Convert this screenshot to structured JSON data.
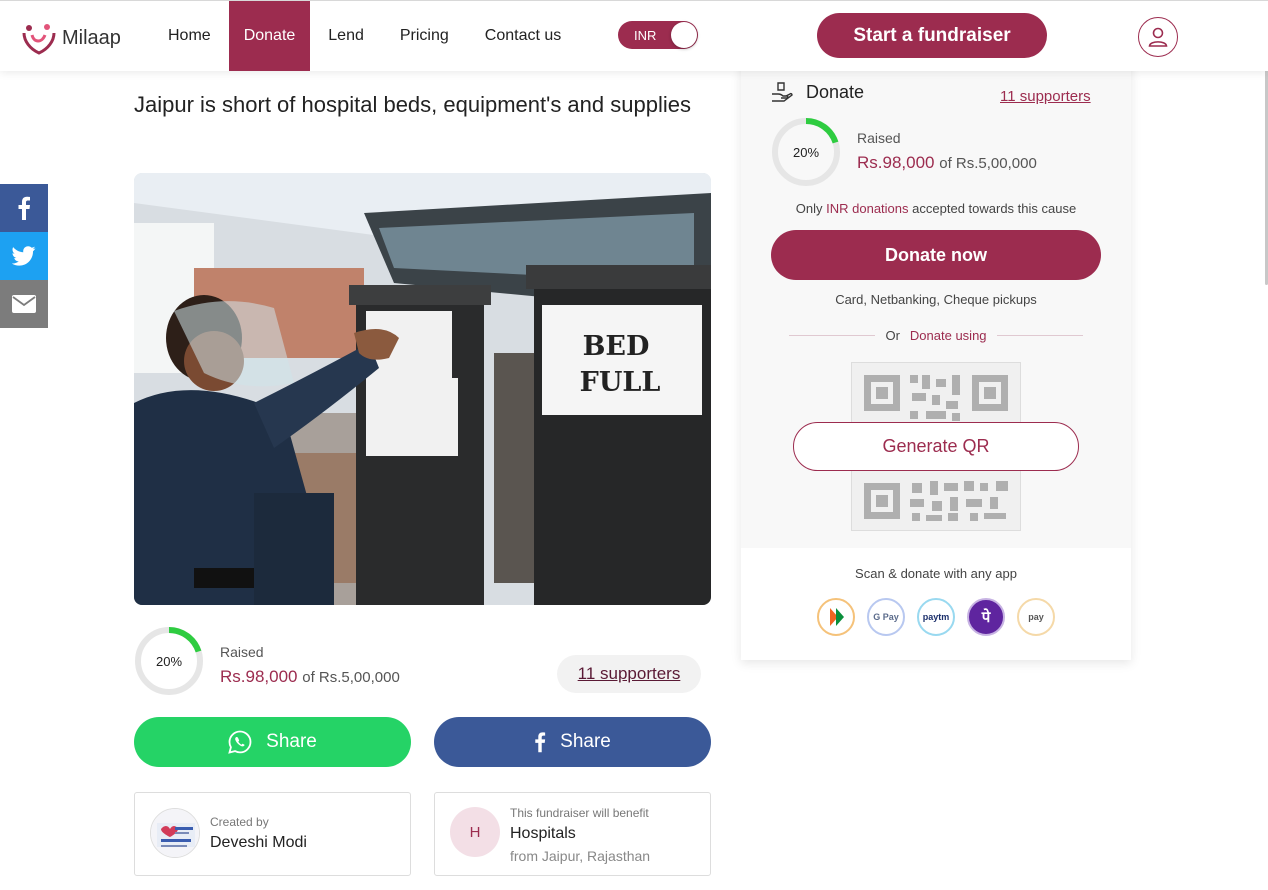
{
  "header": {
    "logo_text": "Milaap",
    "nav": [
      {
        "label": "Home"
      },
      {
        "label": "Donate"
      },
      {
        "label": "Lend"
      },
      {
        "label": "Pricing"
      },
      {
        "label": "Contact us"
      }
    ],
    "currency_toggle": "INR",
    "start_button": "Start a fundraiser"
  },
  "campaign": {
    "title": "Jaipur is short of hospital beds, equipment's and supplies",
    "photo_sign_text_1": "BED",
    "photo_sign_text_2": "FULL",
    "progress_percent": 20,
    "progress_label": "20%",
    "raised_label": "Raised",
    "raised_amount": "Rs.98,000",
    "raised_of": "of Rs.5,00,000",
    "supporters": "11 supporters"
  },
  "share": {
    "whatsapp_label": "Share",
    "facebook_label": "Share"
  },
  "creator": {
    "label": "Created by",
    "name": "Deveshi Modi"
  },
  "beneficiary": {
    "label": "This fundraiser will benefit",
    "initial": "H",
    "name": "Hospitals",
    "location": "from Jaipur, Rajasthan"
  },
  "panel": {
    "heading": "Donate",
    "supporters": "11 supporters",
    "progress_label": "20%",
    "progress_percent": 20,
    "raised_label": "Raised",
    "raised_amount": "Rs.98,000",
    "raised_of": "of Rs.5,00,000",
    "only_prefix": "Only",
    "inr_donations": "INR donations",
    "only_suffix": "accepted towards this cause",
    "donate_now": "Donate now",
    "methods": "Card, Netbanking, Cheque pickups",
    "or": "Or",
    "donate_using": "Donate using",
    "generate_qr": "Generate QR",
    "scan_text": "Scan & donate with any app",
    "apps": [
      {
        "name": "bhim-upi-icon",
        "label": ""
      },
      {
        "name": "google-pay-icon",
        "label": "G Pay"
      },
      {
        "name": "paytm-icon",
        "label": "paytm"
      },
      {
        "name": "phonepe-icon",
        "label": "पे"
      },
      {
        "name": "amazon-pay-icon",
        "label": "pay"
      }
    ]
  },
  "colors": {
    "brand": "#9c2c4f",
    "progress": "#2ecc40",
    "whatsapp": "#25d366",
    "facebook": "#3b5998",
    "twitter": "#1da1f2"
  }
}
